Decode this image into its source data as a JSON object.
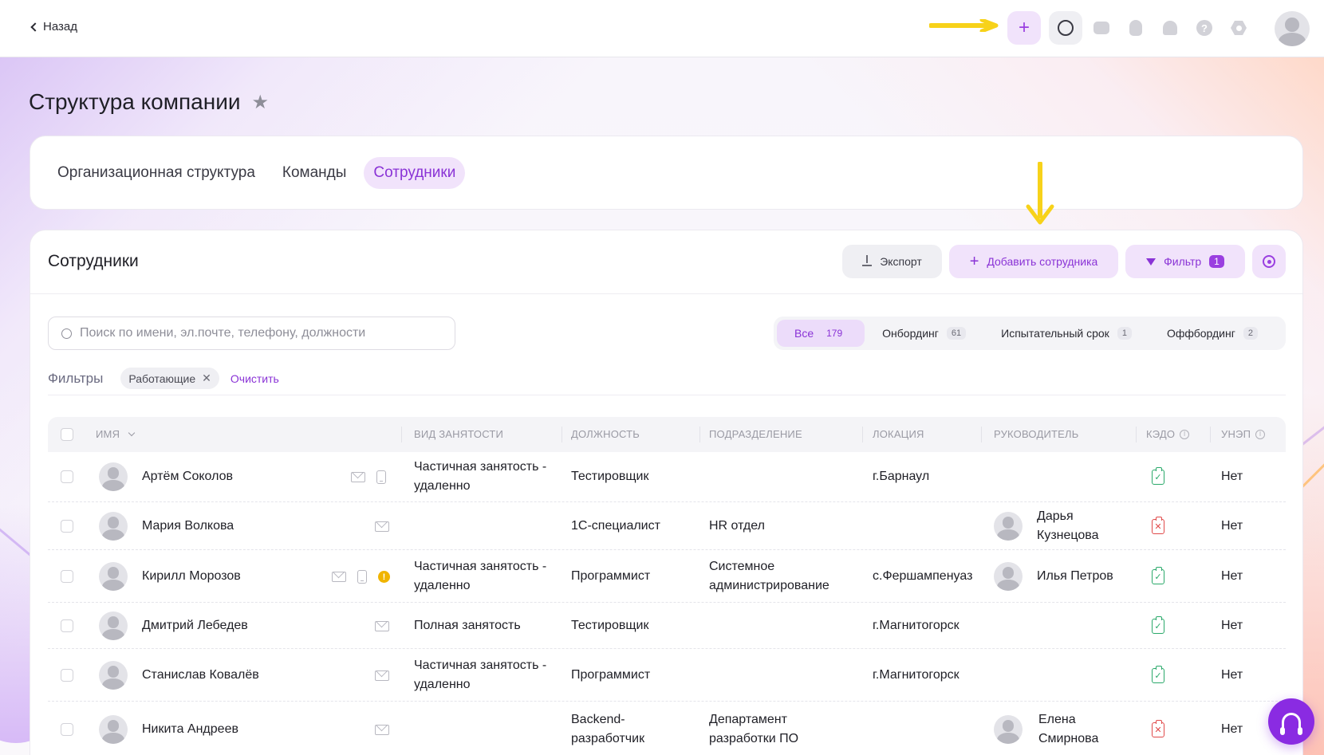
{
  "topbar": {
    "back_label": "Назад"
  },
  "page": {
    "title": "Структура компании"
  },
  "tabs": [
    {
      "label": "Организационная структура",
      "active": false
    },
    {
      "label": "Команды",
      "active": false
    },
    {
      "label": "Сотрудники",
      "active": true
    }
  ],
  "card": {
    "title": "Сотрудники",
    "export_label": "Экспорт",
    "add_label": "Добавить сотрудника",
    "filter_label": "Фильтр",
    "filter_count": "1"
  },
  "search": {
    "placeholder": "Поиск по имени, эл.почте, телефону, должности"
  },
  "segments": [
    {
      "label": "Все",
      "count": "179",
      "active": true
    },
    {
      "label": "Онбординг",
      "count": "61",
      "active": false
    },
    {
      "label": "Испытательный срок",
      "count": "1",
      "active": false
    },
    {
      "label": "Оффбординг",
      "count": "2",
      "active": false
    }
  ],
  "filters": {
    "label": "Фильтры",
    "chip": "Работающие",
    "clear_label": "Очистить"
  },
  "table": {
    "headers": {
      "name": "Имя",
      "employment": "Вид занятости",
      "position": "Должность",
      "department": "Подразделение",
      "location": "Локация",
      "manager": "Руководитель",
      "kedo": "КЭДО",
      "unep": "УНЭП"
    },
    "rows": [
      {
        "name": "Артём Соколов",
        "employment": "Частичная занятость - удаленно",
        "position": "Тестировщик",
        "department": "",
        "location": "г.Барнаул",
        "manager": "",
        "kedo": "ok",
        "unep": "Нет"
      },
      {
        "name": "Мария Волкова",
        "employment": "",
        "position": "1С-специалист",
        "department": "HR отдел",
        "location": "",
        "manager": "Дарья Кузнецова",
        "kedo": "no",
        "unep": "Нет"
      },
      {
        "name": "Кирилл Морозов",
        "employment": "Частичная занятость - удаленно",
        "position": "Программист",
        "department": "Системное администрирование",
        "location": "с.Фершампенуаз",
        "manager": "Илья Петров",
        "kedo": "ok",
        "unep": "Нет"
      },
      {
        "name": "Дмитрий Лебедев",
        "employment": "Полная занятость",
        "position": "Тестировщик",
        "department": "",
        "location": "г.Магнитогорск",
        "manager": "",
        "kedo": "ok",
        "unep": "Нет"
      },
      {
        "name": "Станислав Ковалёв",
        "employment": "Частичная занятость - удаленно",
        "position": "Программист",
        "department": "",
        "location": "г.Магнитогорск",
        "manager": "",
        "kedo": "ok",
        "unep": "Нет"
      },
      {
        "name": "Никита Андреев",
        "employment": "",
        "position": "Backend-разработчик",
        "department": "Департамент разработки ПО",
        "location": "",
        "manager": "Елена Смирнова",
        "kedo": "no",
        "unep": "Нет"
      }
    ]
  },
  "colors": {
    "accent": "#8a33d6",
    "accent_bg": "#f1e3fb",
    "kedo_ok": "#2aa96a",
    "kedo_no": "#e04a4a",
    "annotation_arrow": "#f7d21a"
  },
  "icons": [
    "chevron-left-icon",
    "plus-icon",
    "search-icon",
    "chat-icon",
    "lightbulb-icon",
    "bell-icon",
    "help-icon",
    "settings-icon",
    "avatar",
    "star-icon",
    "download-icon",
    "filter-icon",
    "mail-icon",
    "phone-icon",
    "warning-icon",
    "document-check-icon",
    "document-x-icon",
    "headset-icon"
  ]
}
